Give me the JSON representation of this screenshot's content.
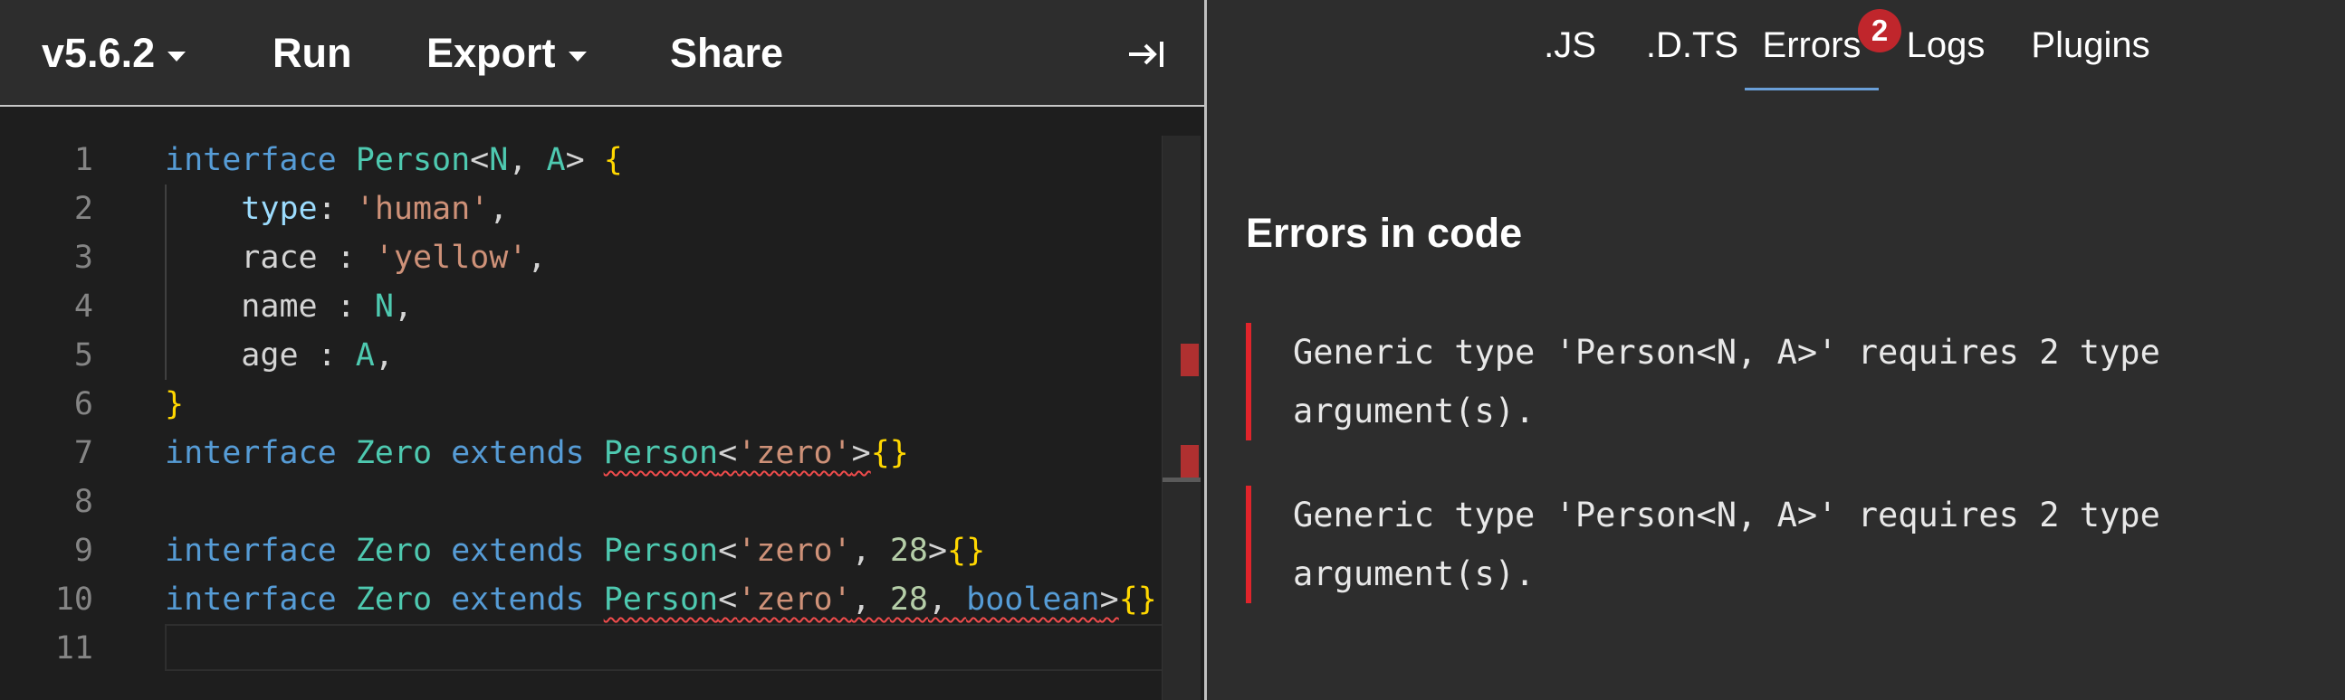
{
  "toolbar": {
    "version_label": "v5.6.2",
    "run_label": "Run",
    "export_label": "Export",
    "share_label": "Share",
    "collapse_icon": "collapse-right-icon"
  },
  "editor": {
    "line_numbers": [
      "1",
      "2",
      "3",
      "4",
      "5",
      "6",
      "7",
      "8",
      "9",
      "10",
      "11"
    ]
  },
  "tabs": {
    "js": ".JS",
    "dts": ".D.TS",
    "errors": "Errors",
    "errors_badge": "2",
    "logs": "Logs",
    "plugins": "Plugins",
    "active": "Errors"
  },
  "errors_panel": {
    "heading": "Errors in code",
    "items": [
      "Generic type 'Person<N, A>' requires 2 type argument(s).",
      "Generic type 'Person<N, A>' requires 2 type argument(s)."
    ]
  },
  "colors": {
    "keyword": "#569cd6",
    "type": "#4ec9b0",
    "string": "#ce9178",
    "number": "#b5cea8",
    "error": "#e0242b",
    "badge": "#c0262c",
    "active_tab_underline": "#6a9fd8"
  }
}
